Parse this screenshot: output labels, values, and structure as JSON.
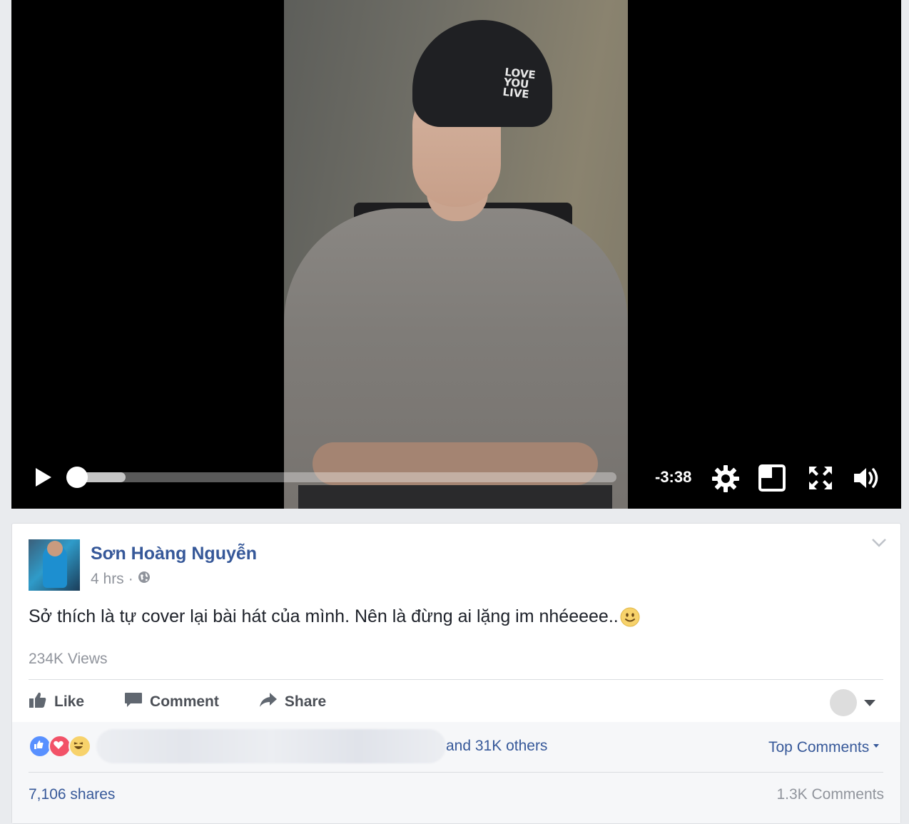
{
  "video": {
    "time_remaining": "-3:38",
    "progress": 0.0,
    "buffered": 0.09,
    "cap_text_lines": [
      "LOVE",
      "YOU",
      "LIVE"
    ],
    "controls": {
      "play_icon": "play-icon",
      "settings_icon": "gear-icon",
      "pip_icon": "picture-in-picture-icon",
      "fullscreen_icon": "fullscreen-icon",
      "volume_icon": "volume-icon"
    }
  },
  "post": {
    "author": "Sơn Hoàng Nguyễn",
    "time": "4 hrs",
    "separator": "·",
    "privacy_icon": "globe-icon",
    "text": "Sở thích là tự cover lại bài hát của mình. Nên là đừng ai lặng im nhéeeee..",
    "emoji_icon": "smile-emoji-icon",
    "views": "234K Views",
    "actions": {
      "like": "Like",
      "comment": "Comment",
      "share": "Share"
    },
    "reactions": {
      "icons": [
        "like-reaction-icon",
        "love-reaction-icon",
        "haha-reaction-icon"
      ],
      "others_text": "and 31K others",
      "sort_label": "Top Comments"
    },
    "shares": "7,106 shares",
    "comments_count": "1.3K Comments"
  },
  "colors": {
    "link_blue": "#365899",
    "muted": "#90949c",
    "text": "#1d2129",
    "background": "#e9ebee"
  }
}
